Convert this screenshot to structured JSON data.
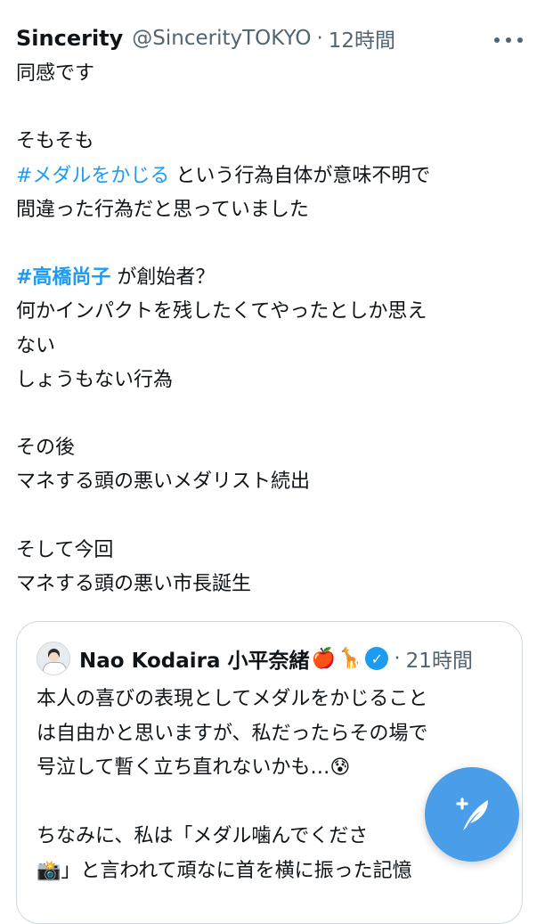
{
  "tweet": {
    "author_name": "Sincerity",
    "handle": "@SincerityTOKYO",
    "separator": "·",
    "time": "12時間",
    "more_icon": "more-horizontal-icon",
    "lines": [
      {
        "text": "同感です"
      },
      {
        "text": ""
      },
      {
        "text": "そもそも"
      },
      {
        "hashtag": "#メダルをかじる",
        "text": " という行為自体が意味不明で"
      },
      {
        "text": "間違った行為だと思っていました"
      },
      {
        "text": ""
      },
      {
        "hashtag": "#高橋尚子",
        "text": " が創始者？"
      },
      {
        "text": "何かインパクトを残したくてやったとしか思え"
      },
      {
        "text": "ない"
      },
      {
        "text": "しょうもない行為"
      },
      {
        "text": ""
      },
      {
        "text": "その後"
      },
      {
        "text": "マネする頭の悪いメダリスト続出"
      },
      {
        "text": ""
      },
      {
        "text": "そして今回"
      },
      {
        "text": "マネする頭の悪い市長誕生"
      }
    ]
  },
  "quoted_tweet": {
    "author_name": "Nao Kodaira 小平奈緒",
    "emoji_apple": "🍎",
    "emoji_deer": "🦒",
    "verified_icon": "verified-badge-icon",
    "separator": "·",
    "time": "21時間",
    "lines": [
      "本人の喜びの表現としてメダルをかじること",
      "は自由かと思いますが、私だったらその場で",
      "号泣して暫く立ち直れないかも…😰",
      "",
      "ちなみに、私は「メダル噛んでくださ",
      "📸」と言われて頑なに首を横に振った記憶"
    ]
  },
  "compose_button": {
    "icon": "compose-feather-icon",
    "color": "#4a9de9"
  },
  "colors": {
    "hashtag": "#1d9bf0",
    "secondary_text": "#536471",
    "border": "#cfd9de"
  }
}
